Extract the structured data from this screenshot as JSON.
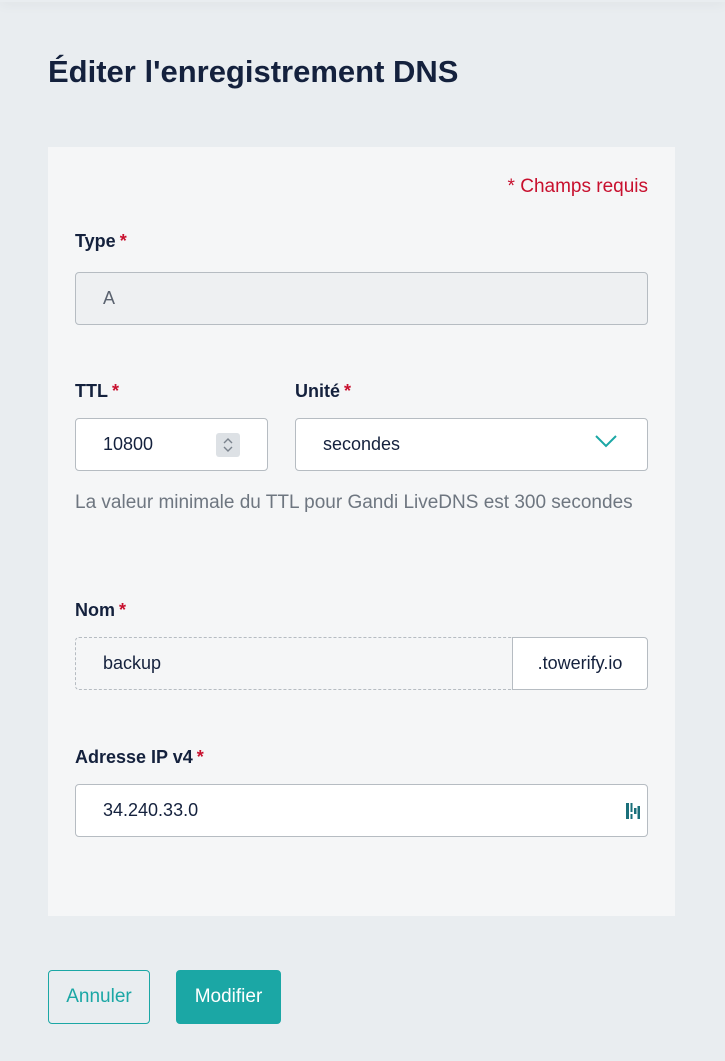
{
  "page": {
    "title": "Éditer l'enregistrement DNS"
  },
  "form": {
    "required_note": "* Champs requis",
    "required_star": "*",
    "type": {
      "label": "Type",
      "value": "A"
    },
    "ttl": {
      "label": "TTL",
      "value": "10800"
    },
    "unit": {
      "label": "Unité",
      "value": "secondes"
    },
    "ttl_help": "La valeur minimale du TTL pour Gandi LiveDNS est 300 secondes",
    "name": {
      "label": "Nom",
      "value": "backup",
      "suffix": ".towerify.io"
    },
    "ipv4": {
      "label": "Adresse IP v4",
      "value": "34.240.33.0"
    }
  },
  "actions": {
    "cancel_label": "Annuler",
    "submit_label": "Modifier"
  },
  "colors": {
    "accent": "#1ba7a5",
    "required": "#c8102e",
    "text": "#14213d",
    "background": "#e9edf0",
    "card": "#f5f6f7"
  },
  "icons": {
    "stepper": "stepper-arrows-icon",
    "dropdown": "chevron-down-icon",
    "ip_field": "password-manager-icon"
  }
}
